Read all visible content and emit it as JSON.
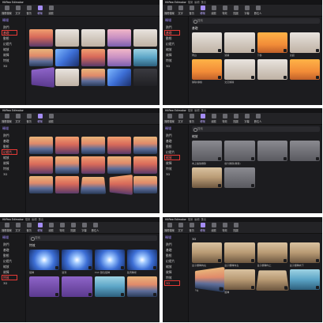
{
  "app": {
    "name": "HitPaw Edimakor",
    "menus": [
      "檔案",
      "編輯",
      "匯出"
    ],
    "toolbar": [
      {
        "label": "媒體檔案",
        "icon": "media-icon"
      },
      {
        "label": "文字",
        "icon": "text-icon"
      },
      {
        "label": "音訊",
        "icon": "audio-icon"
      },
      {
        "label": "轉場",
        "icon": "transition-icon"
      },
      {
        "label": "濾鏡",
        "icon": "filter-icon"
      },
      {
        "label": "特效",
        "icon": "effect-icon"
      },
      {
        "label": "貼圖",
        "icon": "sticker-icon"
      },
      {
        "label": "字幕",
        "icon": "subtitle-icon"
      },
      {
        "label": "數位人",
        "icon": "avatar-icon"
      }
    ]
  },
  "sidebar": {
    "header": "轉場",
    "items": [
      "熱門",
      "基礎",
      "動態",
      "幻燈片",
      "縮放",
      "故障",
      "特效",
      "3D"
    ]
  },
  "search_placeholder": "搜索",
  "panels": [
    {
      "selected": "基礎",
      "active_tool": "轉場"
    },
    {
      "selected": "基礎",
      "active_tool": "轉場",
      "section": "基礎",
      "tiles": [
        "閃白",
        "溶解",
        "下移",
        "交錯",
        "擦除/擦線",
        "交叉擦除",
        "",
        ""
      ]
    },
    {
      "selected": "幻燈片",
      "active_tool": "轉場"
    },
    {
      "selected": "縮放",
      "active_tool": "轉場",
      "section": "縮放",
      "tiles": [
        "向上縮放推移",
        "放大推移(推移)",
        "",
        "",
        "",
        "",
        "",
        ""
      ]
    },
    {
      "selected": "特效",
      "active_tool": "轉場",
      "section": "特效",
      "tiles": [
        "旋轉",
        "漩渦",
        "RGC 數位旋轉",
        "漩渦轉場",
        "",
        "",
        "",
        ""
      ]
    },
    {
      "selected": "3D",
      "active_tool": "轉場",
      "section": "3D",
      "tiles": [
        "盒子翻轉向右",
        "盒子翻轉向左",
        "盒子翻轉向上",
        "盒子翻轉向下",
        "方塊",
        "旋轉",
        "",
        ""
      ]
    }
  ],
  "colors": {
    "accent": "#a58df6",
    "highlight": "#e53935",
    "bg": "#1c1c1f"
  }
}
